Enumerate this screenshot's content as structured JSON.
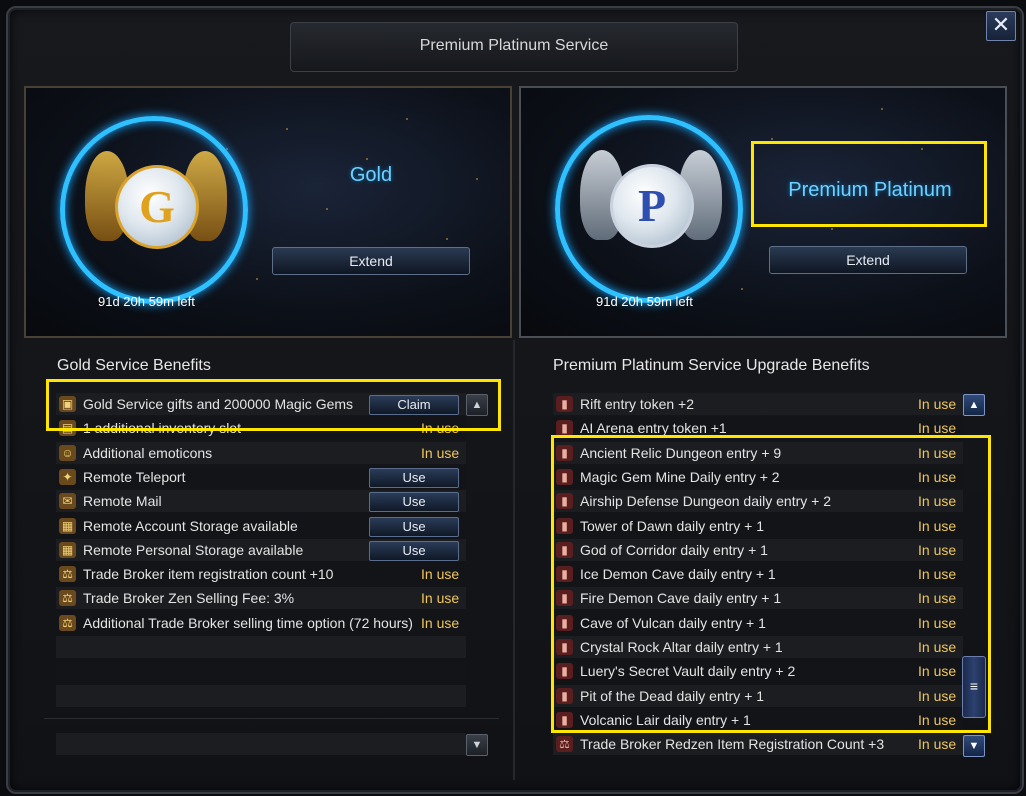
{
  "window": {
    "title": "Premium Platinum Service",
    "close_label": "✕"
  },
  "gold_panel": {
    "emblem_letter": "G",
    "name": "Gold",
    "time_left": "91d 20h 59m left",
    "extend_label": "Extend"
  },
  "platinum_panel": {
    "emblem_letter": "P",
    "name": "Premium Platinum",
    "time_left": "91d 20h 59m left",
    "extend_label": "Extend"
  },
  "gold_benefits": {
    "title": "Gold Service Benefits",
    "items": [
      {
        "icon": "gift-box-icon",
        "glyph": "▣",
        "label": "Gold Service gifts and 200000 Magic Gems",
        "status": "",
        "button": "Claim"
      },
      {
        "icon": "inventory-slot-icon",
        "glyph": "▤",
        "label": "1 additional inventory slot",
        "status": "In use",
        "button": ""
      },
      {
        "icon": "emoticon-icon",
        "glyph": "☺",
        "label": "Additional emoticons",
        "status": "In use",
        "button": ""
      },
      {
        "icon": "teleport-wing-icon",
        "glyph": "✦",
        "label": "Remote Teleport",
        "status": "",
        "button": "Use"
      },
      {
        "icon": "mail-icon",
        "glyph": "✉",
        "label": "Remote Mail",
        "status": "",
        "button": "Use"
      },
      {
        "icon": "account-storage-icon",
        "glyph": "▦",
        "label": "Remote Account Storage available",
        "status": "",
        "button": "Use"
      },
      {
        "icon": "personal-storage-icon",
        "glyph": "▦",
        "label": "Remote Personal Storage available",
        "status": "",
        "button": "Use"
      },
      {
        "icon": "trade-scale-icon",
        "glyph": "⚖",
        "label": "Trade Broker item registration count +10",
        "status": "In use",
        "button": ""
      },
      {
        "icon": "trade-scale-icon",
        "glyph": "⚖",
        "label": "Trade Broker Zen Selling Fee: 3%",
        "status": "In use",
        "button": ""
      },
      {
        "icon": "trade-scale-icon",
        "glyph": "⚖",
        "label": "Additional Trade Broker selling time option (72 hours)",
        "status": "In use",
        "button": ""
      }
    ]
  },
  "platinum_benefits": {
    "title": "Premium Platinum Service Upgrade Benefits",
    "items": [
      {
        "icon": "entry-token-icon",
        "glyph": "▮",
        "label": "Rift entry token +2",
        "status": "In use"
      },
      {
        "icon": "entry-token-icon",
        "glyph": "▮",
        "label": "AI Arena entry token +1",
        "status": "In use"
      },
      {
        "icon": "entry-token-icon",
        "glyph": "▮",
        "label": "Ancient Relic Dungeon entry + 9",
        "status": "In use"
      },
      {
        "icon": "entry-token-icon",
        "glyph": "▮",
        "label": "Magic Gem Mine Daily entry + 2",
        "status": "In use"
      },
      {
        "icon": "entry-token-icon",
        "glyph": "▮",
        "label": "Airship Defense Dungeon daily entry + 2",
        "status": "In use"
      },
      {
        "icon": "entry-token-icon",
        "glyph": "▮",
        "label": "Tower of Dawn daily entry + 1",
        "status": "In use"
      },
      {
        "icon": "entry-token-icon",
        "glyph": "▮",
        "label": "God of Corridor daily entry + 1",
        "status": "In use"
      },
      {
        "icon": "entry-token-icon",
        "glyph": "▮",
        "label": "Ice Demon Cave daily entry + 1",
        "status": "In use"
      },
      {
        "icon": "entry-token-icon",
        "glyph": "▮",
        "label": "Fire Demon Cave daily entry + 1",
        "status": "In use"
      },
      {
        "icon": "entry-token-icon",
        "glyph": "▮",
        "label": "Cave of Vulcan daily entry + 1",
        "status": "In use"
      },
      {
        "icon": "entry-token-icon",
        "glyph": "▮",
        "label": "Crystal Rock Altar daily entry + 1",
        "status": "In use"
      },
      {
        "icon": "entry-token-icon",
        "glyph": "▮",
        "label": "Luery's Secret Vault daily entry + 2",
        "status": "In use"
      },
      {
        "icon": "entry-token-icon",
        "glyph": "▮",
        "label": "Pit of the Dead daily entry + 1",
        "status": "In use"
      },
      {
        "icon": "entry-token-icon",
        "glyph": "▮",
        "label": "Volcanic Lair daily entry + 1",
        "status": "In use"
      },
      {
        "icon": "trade-scale-icon",
        "glyph": "⚖",
        "label": "Trade Broker Redzen Item Registration Count +3",
        "status": "In use"
      }
    ]
  },
  "scroll": {
    "up_glyph": "▲",
    "down_glyph": "▼",
    "thumb_glyph": "≡"
  },
  "colors": {
    "accent_blue": "#2ec0ff",
    "status_gold": "#f1c75b",
    "highlight_yellow": "#ffe600"
  }
}
